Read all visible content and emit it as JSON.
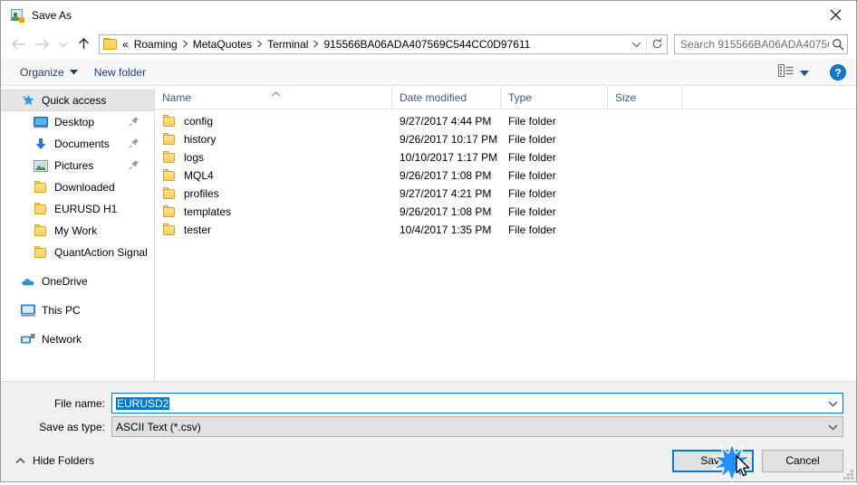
{
  "window": {
    "title": "Save As",
    "title_icon": "save-as-icon",
    "close_icon": "close-icon"
  },
  "nav": {
    "back_icon": "back-arrow-icon",
    "forward_icon": "forward-arrow-icon",
    "recent_icon": "recent-locations-chevron-icon",
    "up_icon": "up-arrow-icon",
    "breadcrumb_folder_icon": "folder-icon",
    "breadcrumb_prefix": "«",
    "breadcrumb": [
      "Roaming",
      "MetaQuotes",
      "Terminal",
      "915566BA06ADA407569C544CC0D97611"
    ],
    "address_dropdown_icon": "chevron-down-icon",
    "refresh_icon": "refresh-icon"
  },
  "search": {
    "placeholder": "Search 915566BA06ADA40756...",
    "icon": "search-icon"
  },
  "toolbar": {
    "organize_label": "Organize",
    "organize_caret_icon": "caret-down-icon",
    "new_folder_label": "New folder",
    "view_icon": "view-options-icon",
    "view_caret_icon": "caret-down-icon",
    "help_icon": "help-icon"
  },
  "sidebar": {
    "items": [
      {
        "label": "Quick access",
        "icon": "quick-access-star-icon",
        "level": "root",
        "selected": true,
        "pinned": false
      },
      {
        "label": "Desktop",
        "icon": "desktop-icon",
        "level": "child",
        "selected": false,
        "pinned": true
      },
      {
        "label": "Documents",
        "icon": "documents-download-icon",
        "level": "child",
        "selected": false,
        "pinned": true
      },
      {
        "label": "Pictures",
        "icon": "pictures-icon",
        "level": "child",
        "selected": false,
        "pinned": true
      },
      {
        "label": "Downloaded",
        "icon": "folder-icon",
        "level": "child",
        "selected": false,
        "pinned": false
      },
      {
        "label": "EURUSD H1",
        "icon": "folder-icon",
        "level": "child",
        "selected": false,
        "pinned": false
      },
      {
        "label": "My Work",
        "icon": "folder-icon",
        "level": "child",
        "selected": false,
        "pinned": false
      },
      {
        "label": "QuantAction Signal",
        "icon": "folder-icon",
        "level": "child",
        "selected": false,
        "pinned": false
      },
      {
        "label": "OneDrive",
        "icon": "onedrive-cloud-icon",
        "level": "root",
        "selected": false,
        "pinned": false,
        "gap_before": true
      },
      {
        "label": "This PC",
        "icon": "this-pc-icon",
        "level": "root",
        "selected": false,
        "pinned": false,
        "gap_before": true
      },
      {
        "label": "Network",
        "icon": "network-icon",
        "level": "root",
        "selected": false,
        "pinned": false,
        "gap_before": true
      }
    ]
  },
  "filelist": {
    "columns": [
      "Name",
      "Date modified",
      "Type",
      "Size"
    ],
    "sort_indicator": "sort-ascending-caret-icon",
    "rows": [
      {
        "name": "config",
        "date": "9/27/2017 4:44 PM",
        "type": "File folder",
        "size": ""
      },
      {
        "name": "history",
        "date": "9/26/2017 10:17 PM",
        "type": "File folder",
        "size": ""
      },
      {
        "name": "logs",
        "date": "10/10/2017 1:17 PM",
        "type": "File folder",
        "size": ""
      },
      {
        "name": "MQL4",
        "date": "9/26/2017 1:08 PM",
        "type": "File folder",
        "size": ""
      },
      {
        "name": "profiles",
        "date": "9/27/2017 4:21 PM",
        "type": "File folder",
        "size": ""
      },
      {
        "name": "templates",
        "date": "9/26/2017 1:08 PM",
        "type": "File folder",
        "size": ""
      },
      {
        "name": "tester",
        "date": "10/4/2017 1:35 PM",
        "type": "File folder",
        "size": ""
      }
    ]
  },
  "form": {
    "file_name_label": "File name:",
    "file_name_value": "EURUSD2",
    "file_name_dropdown_icon": "chevron-down-icon",
    "save_type_label": "Save as type:",
    "save_type_value": "ASCII Text (*.csv)",
    "save_type_dropdown_icon": "chevron-down-icon"
  },
  "footer": {
    "hide_folders_label": "Hide Folders",
    "hide_folders_icon": "chevron-up-icon",
    "save_label": "Save",
    "cancel_label": "Cancel",
    "resize_grip_icon": "resize-grip-icon"
  },
  "colors": {
    "accent": "#0078d7",
    "selection": "#0078d7",
    "folder": "#ffd966",
    "header_text": "#3c5a84"
  }
}
